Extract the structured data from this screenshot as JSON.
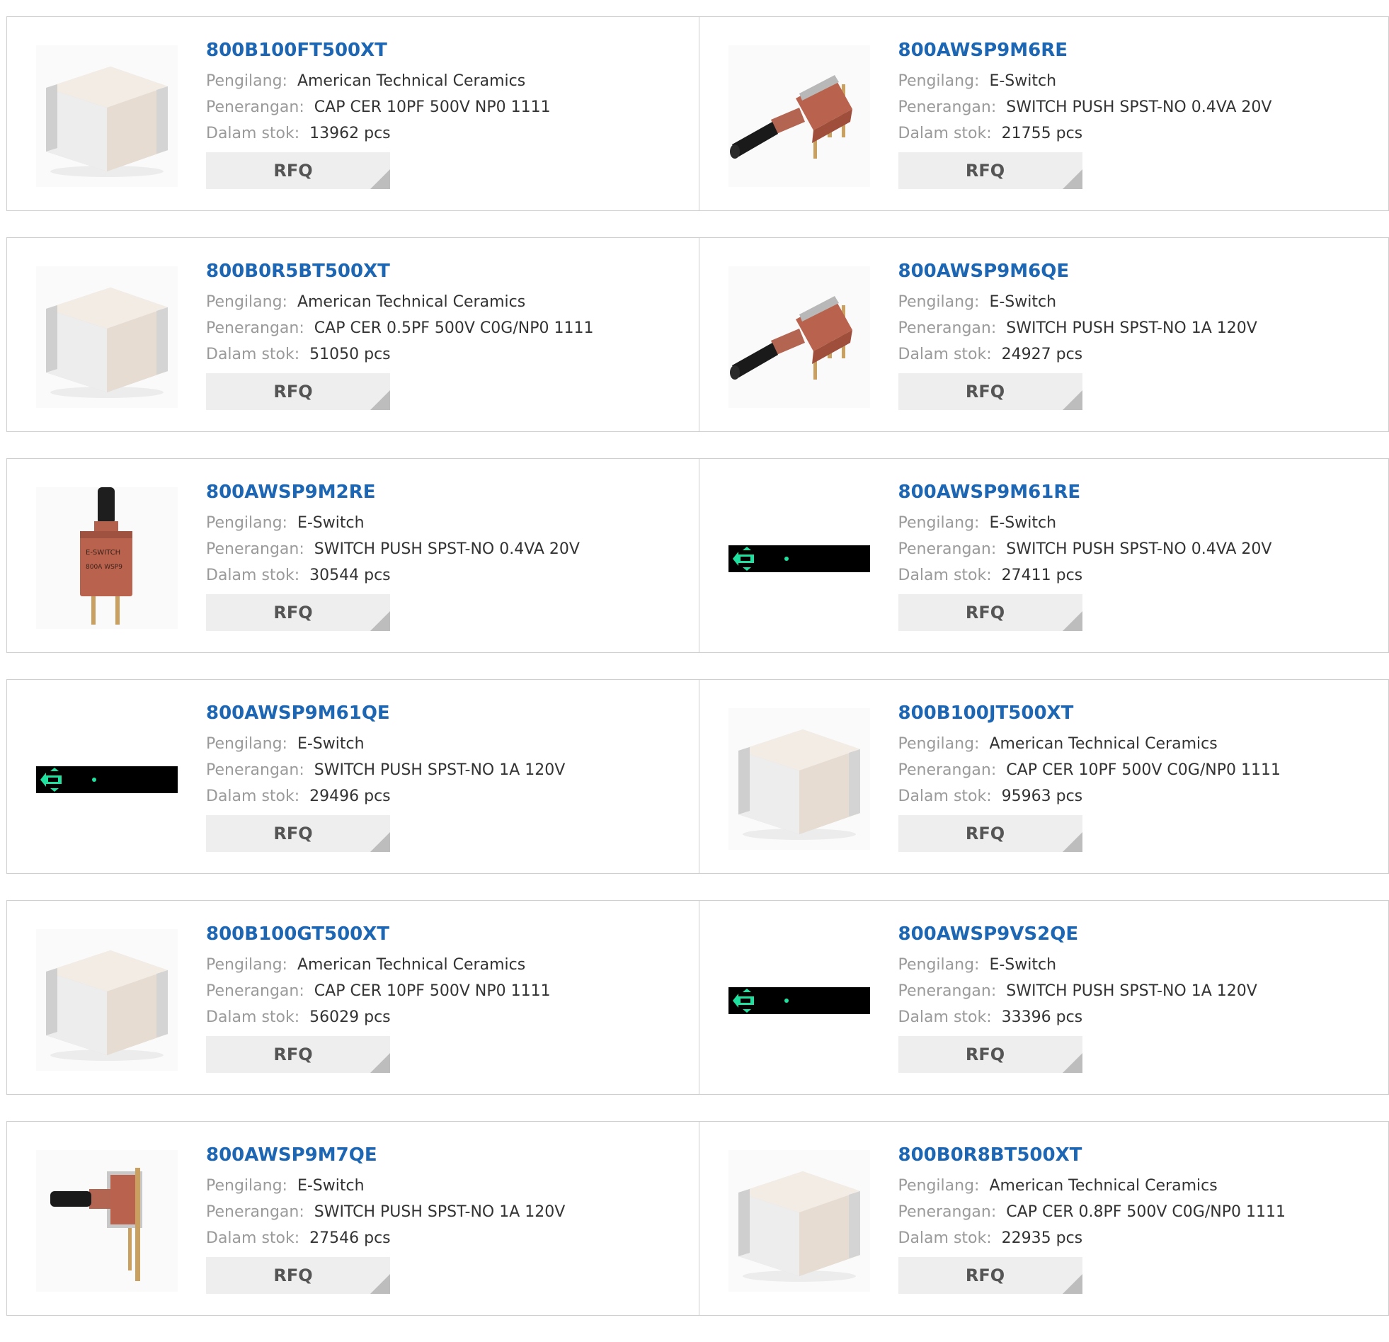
{
  "labels": {
    "manufacturer": "Pengilang:",
    "description": "Penerangan:",
    "stock": "Dalam stok:",
    "rfq": "RFQ"
  },
  "colors": {
    "part_link": "#1c66b3",
    "label": "#9a9a9a",
    "value": "#333333",
    "rfq_bg": "#eeeeee"
  },
  "products": [
    {
      "part": "800B100FT500XT",
      "manufacturer": "American Technical Ceramics",
      "description": "CAP CER 10PF 500V NP0 1111",
      "stock": "13962 pcs",
      "image": "capacitor-image"
    },
    {
      "part": "800AWSP9M6RE",
      "manufacturer": "E-Switch",
      "description": "SWITCH PUSH SPST-NO 0.4VA 20V",
      "stock": "21755 pcs",
      "image": "switch-angled-image"
    },
    {
      "part": "800B0R5BT500XT",
      "manufacturer": "American Technical Ceramics",
      "description": "CAP CER 0.5PF 500V C0G/NP0 1111",
      "stock": "51050 pcs",
      "image": "capacitor-image"
    },
    {
      "part": "800AWSP9M6QE",
      "manufacturer": "E-Switch",
      "description": "SWITCH PUSH SPST-NO 1A 120V",
      "stock": "24927 pcs",
      "image": "switch-angled-image"
    },
    {
      "part": "800AWSP9M2RE",
      "manufacturer": "E-Switch",
      "description": "SWITCH PUSH SPST-NO 0.4VA 20V",
      "stock": "30544 pcs",
      "image": "switch-vertical-image"
    },
    {
      "part": "800AWSP9M61RE",
      "manufacturer": "E-Switch",
      "description": "SWITCH PUSH SPST-NO 0.4VA 20V",
      "stock": "27411 pcs",
      "image": "placeholder-image"
    },
    {
      "part": "800AWSP9M61QE",
      "manufacturer": "E-Switch",
      "description": "SWITCH PUSH SPST-NO 1A 120V",
      "stock": "29496 pcs",
      "image": "placeholder-image"
    },
    {
      "part": "800B100JT500XT",
      "manufacturer": "American Technical Ceramics",
      "description": "CAP CER 10PF 500V C0G/NP0 1111",
      "stock": "95963 pcs",
      "image": "capacitor-image"
    },
    {
      "part": "800B100GT500XT",
      "manufacturer": "American Technical Ceramics",
      "description": "CAP CER 10PF 500V NP0 1111",
      "stock": "56029 pcs",
      "image": "capacitor-image"
    },
    {
      "part": "800AWSP9VS2QE",
      "manufacturer": "E-Switch",
      "description": "SWITCH PUSH SPST-NO 1A 120V",
      "stock": "33396 pcs",
      "image": "placeholder-image"
    },
    {
      "part": "800AWSP9M7QE",
      "manufacturer": "E-Switch",
      "description": "SWITCH PUSH SPST-NO 1A 120V",
      "stock": "27546 pcs",
      "image": "switch-rightangle-image"
    },
    {
      "part": "800B0R8BT500XT",
      "manufacturer": "American Technical Ceramics",
      "description": "CAP CER 0.8PF 500V C0G/NP0 1111",
      "stock": "22935 pcs",
      "image": "capacitor-image"
    }
  ]
}
